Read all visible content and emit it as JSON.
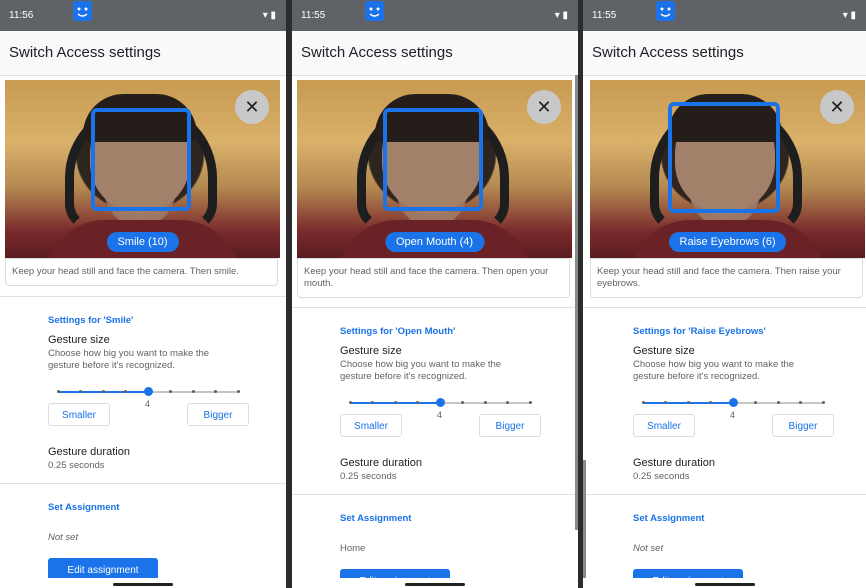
{
  "panels": [
    {
      "time": "11:56",
      "title": "Switch Access settings",
      "gesture_pill": "Smile (10)",
      "instruction": "Keep your head still and face the camera. Then smile.",
      "settings_header": "Settings for 'Smile'",
      "gesture_size_title": "Gesture size",
      "gesture_size_desc": "Choose how big you want to make the gesture before it's recognized.",
      "slider_value": "4",
      "smaller_label": "Smaller",
      "bigger_label": "Bigger",
      "gesture_duration_title": "Gesture duration",
      "gesture_duration_value": "0.25 seconds",
      "set_assignment_label": "Set Assignment",
      "assignment_value": "Not set",
      "edit_assignment_label": "Edit assignment"
    },
    {
      "time": "11:55",
      "title": "Switch Access settings",
      "gesture_pill": "Open Mouth (4)",
      "instruction": "Keep your head still and face the camera. Then open your mouth.",
      "settings_header": "Settings for 'Open Mouth'",
      "gesture_size_title": "Gesture size",
      "gesture_size_desc": "Choose how big you want to make the gesture before it's recognized.",
      "slider_value": "4",
      "smaller_label": "Smaller",
      "bigger_label": "Bigger",
      "gesture_duration_title": "Gesture duration",
      "gesture_duration_value": "0.25 seconds",
      "set_assignment_label": "Set Assignment",
      "assignment_value": "Home",
      "edit_assignment_label": "Edit assignment"
    },
    {
      "time": "11:55",
      "title": "Switch Access settings",
      "gesture_pill": "Raise Eyebrows (6)",
      "instruction": "Keep your head still and face the camera. Then raise your eyebrows.",
      "settings_header": "Settings for 'Raise Eyebrows'",
      "gesture_size_title": "Gesture size",
      "gesture_size_desc": "Choose how big you want to make the gesture before it's recognized.",
      "slider_value": "4",
      "smaller_label": "Smaller",
      "bigger_label": "Bigger",
      "gesture_duration_title": "Gesture duration",
      "gesture_duration_value": "0.25 seconds",
      "set_assignment_label": "Set Assignment",
      "assignment_value": "Not set",
      "edit_assignment_label": "Edit assignment"
    }
  ],
  "slider": {
    "steps": 9,
    "selected_step": 4
  },
  "status_icons": {
    "app": "face-icon",
    "wifi": "wifi-icon",
    "battery": "battery-icon"
  },
  "colors": {
    "accent": "#1a73e8",
    "statusbar": "#5f6368"
  }
}
